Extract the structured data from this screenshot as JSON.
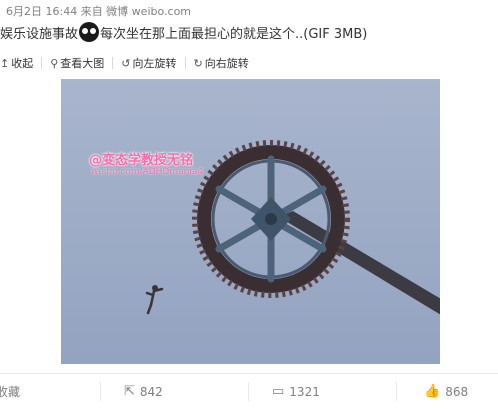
{
  "post": {
    "meta": "6月2日 16:44 来自 微博 weibo.com",
    "title_before": "娱乐设施事故",
    "title_after": "每次坐在那上面最担心的就是这个..(GIF 3MB)"
  },
  "toolbar": {
    "collapse": "收起",
    "view_large": "查看大图",
    "rotate_left": "向左旋转",
    "rotate_right": "向右旋转"
  },
  "media": {
    "watermark_name": "@变态学教授无铭",
    "watermark_url": "weibo.com/ADHDmania4"
  },
  "actions": {
    "favorite": "收藏",
    "forward_count": "842",
    "comment_count": "1321",
    "like_count": "868"
  },
  "colors": {
    "watermark": "#ff6aa8",
    "sky": "#9aa9c4"
  }
}
